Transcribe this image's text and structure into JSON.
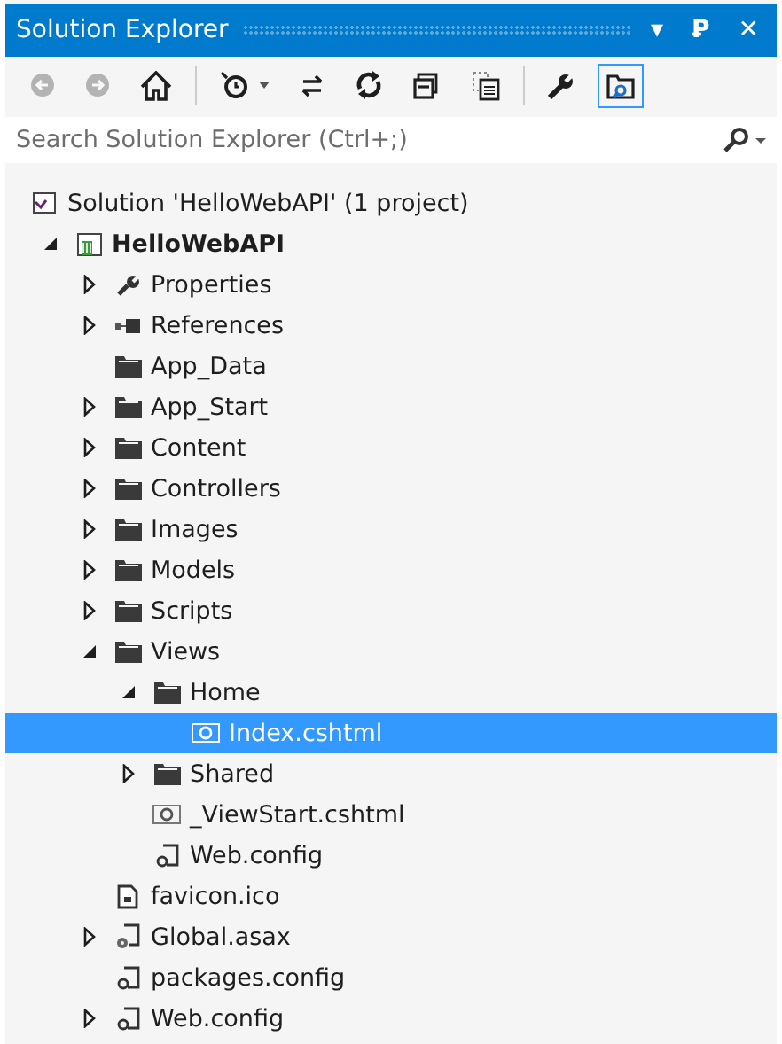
{
  "window": {
    "title": "Solution Explorer",
    "controls": [
      "▾",
      "Ꝑ",
      "✕"
    ]
  },
  "toolbar": [
    [
      {
        "kind": "back",
        "disabled": true,
        "pressed": false
      },
      {
        "kind": "forward",
        "disabled": true,
        "pressed": false
      },
      {
        "kind": "home",
        "disabled": false,
        "pressed": false
      }
    ],
    [
      {
        "kind": "history",
        "disabled": false,
        "pressed": false,
        "dropdown": true
      },
      {
        "kind": "sync",
        "disabled": false,
        "pressed": false
      },
      {
        "kind": "refresh",
        "disabled": false,
        "pressed": false
      },
      {
        "kind": "collapse",
        "disabled": false,
        "pressed": false
      },
      {
        "kind": "show-all",
        "disabled": false,
        "pressed": false
      }
    ],
    [
      {
        "kind": "wrench",
        "disabled": false,
        "pressed": false
      },
      {
        "kind": "preview",
        "disabled": false,
        "pressed": true
      }
    ]
  ],
  "search": {
    "placeholder": "Search Solution Explorer (Ctrl+;)"
  },
  "tree": [
    {
      "label": "Solution 'HelloWebAPI' (1 project)",
      "kind": "solution",
      "selected": false,
      "children": [
        {
          "label": "HelloWebAPI",
          "kind": "project",
          "expanded": true,
          "selected": false,
          "children": [
            {
              "label": "Properties",
              "kind": "wrench",
              "expanded": false,
              "selected": false
            },
            {
              "label": "References",
              "kind": "references",
              "expanded": false,
              "selected": false
            },
            {
              "label": "App_Data",
              "kind": "folder",
              "selected": false
            },
            {
              "label": "App_Start",
              "kind": "folder",
              "expanded": false,
              "selected": false
            },
            {
              "label": "Content",
              "kind": "folder",
              "expanded": false,
              "selected": false
            },
            {
              "label": "Controllers",
              "kind": "folder",
              "expanded": false,
              "selected": false
            },
            {
              "label": "Images",
              "kind": "folder",
              "expanded": false,
              "selected": false
            },
            {
              "label": "Models",
              "kind": "folder",
              "expanded": false,
              "selected": false
            },
            {
              "label": "Scripts",
              "kind": "folder",
              "expanded": false,
              "selected": false
            },
            {
              "label": "Views",
              "kind": "folder",
              "expanded": true,
              "selected": false,
              "children": [
                {
                  "label": "Home",
                  "kind": "folder",
                  "expanded": true,
                  "selected": false,
                  "children": [
                    {
                      "label": "Index.cshtml",
                      "kind": "razor",
                      "selected": true
                    }
                  ]
                },
                {
                  "label": "Shared",
                  "kind": "folder",
                  "expanded": false,
                  "selected": false
                },
                {
                  "label": "_ViewStart.cshtml",
                  "kind": "razor",
                  "selected": false
                },
                {
                  "label": "Web.config",
                  "kind": "config",
                  "selected": false
                }
              ]
            },
            {
              "label": "favicon.ico",
              "kind": "image-file",
              "selected": false
            },
            {
              "label": "Global.asax",
              "kind": "asax",
              "expanded": false,
              "selected": false
            },
            {
              "label": "packages.config",
              "kind": "config",
              "selected": false
            },
            {
              "label": "Web.config",
              "kind": "config",
              "expanded": false,
              "selected": false
            }
          ]
        }
      ]
    }
  ]
}
